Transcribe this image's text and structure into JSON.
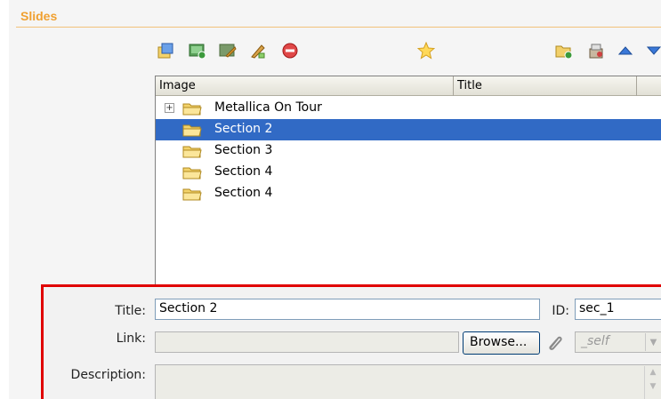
{
  "panel": {
    "title": "Slides"
  },
  "toolbar": {
    "left_icons": [
      "add-slide-icon",
      "add-image-icon",
      "edit-slide-icon",
      "properties-icon",
      "delete-icon"
    ],
    "center_icon": "favorite-star-icon",
    "right_icons": [
      "new-folder-icon",
      "import-icon",
      "move-up-icon",
      "move-down-icon"
    ]
  },
  "tree": {
    "columns": [
      "Image",
      "Title"
    ],
    "rows": [
      {
        "label": "Metallica On Tour",
        "expandable": true,
        "selected": false
      },
      {
        "label": "Section 2",
        "expandable": false,
        "selected": true
      },
      {
        "label": "Section 3",
        "expandable": false,
        "selected": false
      },
      {
        "label": "Section 4",
        "expandable": false,
        "selected": false
      },
      {
        "label": "Section 4",
        "expandable": false,
        "selected": false
      }
    ]
  },
  "form": {
    "title_label": "Title:",
    "title_value": "Section 2",
    "id_label": "ID:",
    "id_value": "sec_1",
    "link_label": "Link:",
    "link_value": "",
    "browse_label": "Browse...",
    "target_value": "_self",
    "description_label": "Description:",
    "description_value": ""
  },
  "colors": {
    "accent": "#f0a030",
    "selection": "#316ac5",
    "editor_border": "#e00000"
  }
}
